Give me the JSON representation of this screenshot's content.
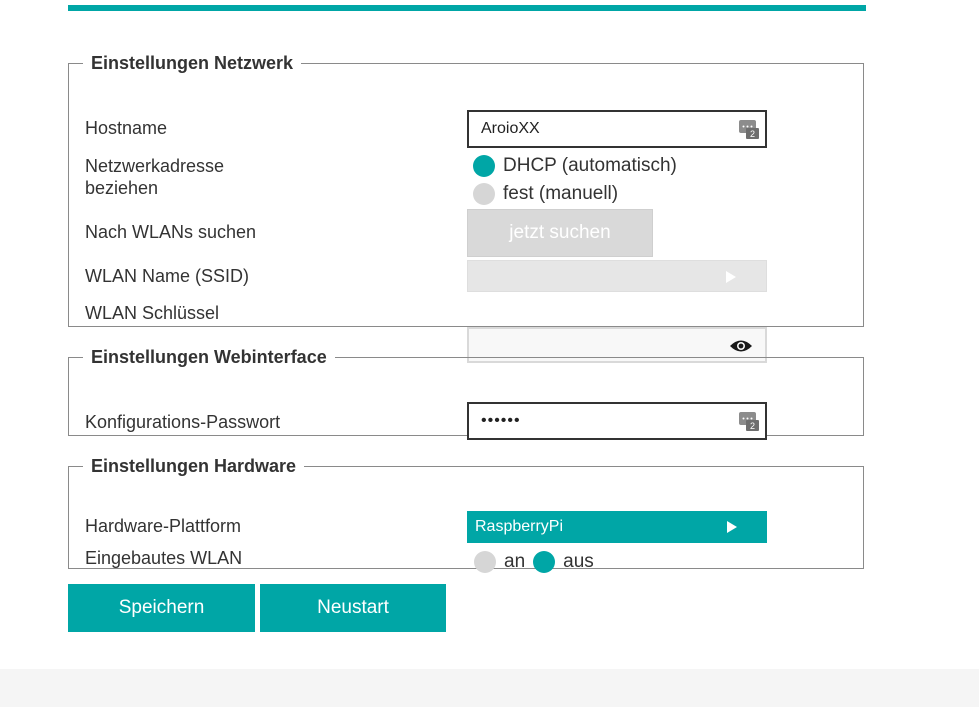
{
  "network": {
    "legend": "Einstellungen Netzwerk",
    "hostname_label": "Hostname",
    "hostname_value": "AroioXX",
    "address_label_line1": "Netzwerkadresse",
    "address_label_line2": "beziehen",
    "dhcp_label": "DHCP (automatisch)",
    "static_label": "fest (manuell)",
    "scan_label": "Nach WLANs suchen",
    "scan_button": "jetzt suchen",
    "ssid_label": "WLAN Name (SSID)",
    "ssid_value": "",
    "key_label": "WLAN Schlüssel"
  },
  "webinterface": {
    "legend": "Einstellungen Webinterface",
    "password_label": "Konfigurations-Passwort",
    "password_value": "••••••"
  },
  "hardware": {
    "legend": "Einstellungen Hardware",
    "platform_label": "Hardware-Plattform",
    "platform_value": "RaspberryPi",
    "wlan_label": "Eingebautes WLAN",
    "wlan_on_label": "an",
    "wlan_off_label": "aus"
  },
  "actions": {
    "save_label": "Speichern",
    "restart_label": "Neustart"
  },
  "colors": {
    "accent": "#00a6a6",
    "radio_off": "#d6d6d6",
    "disabled": "#d9d9d9"
  },
  "icons": {
    "keyboard": "keyboard-icon",
    "eye": "eye-icon",
    "triangle": "play-triangle-icon"
  }
}
